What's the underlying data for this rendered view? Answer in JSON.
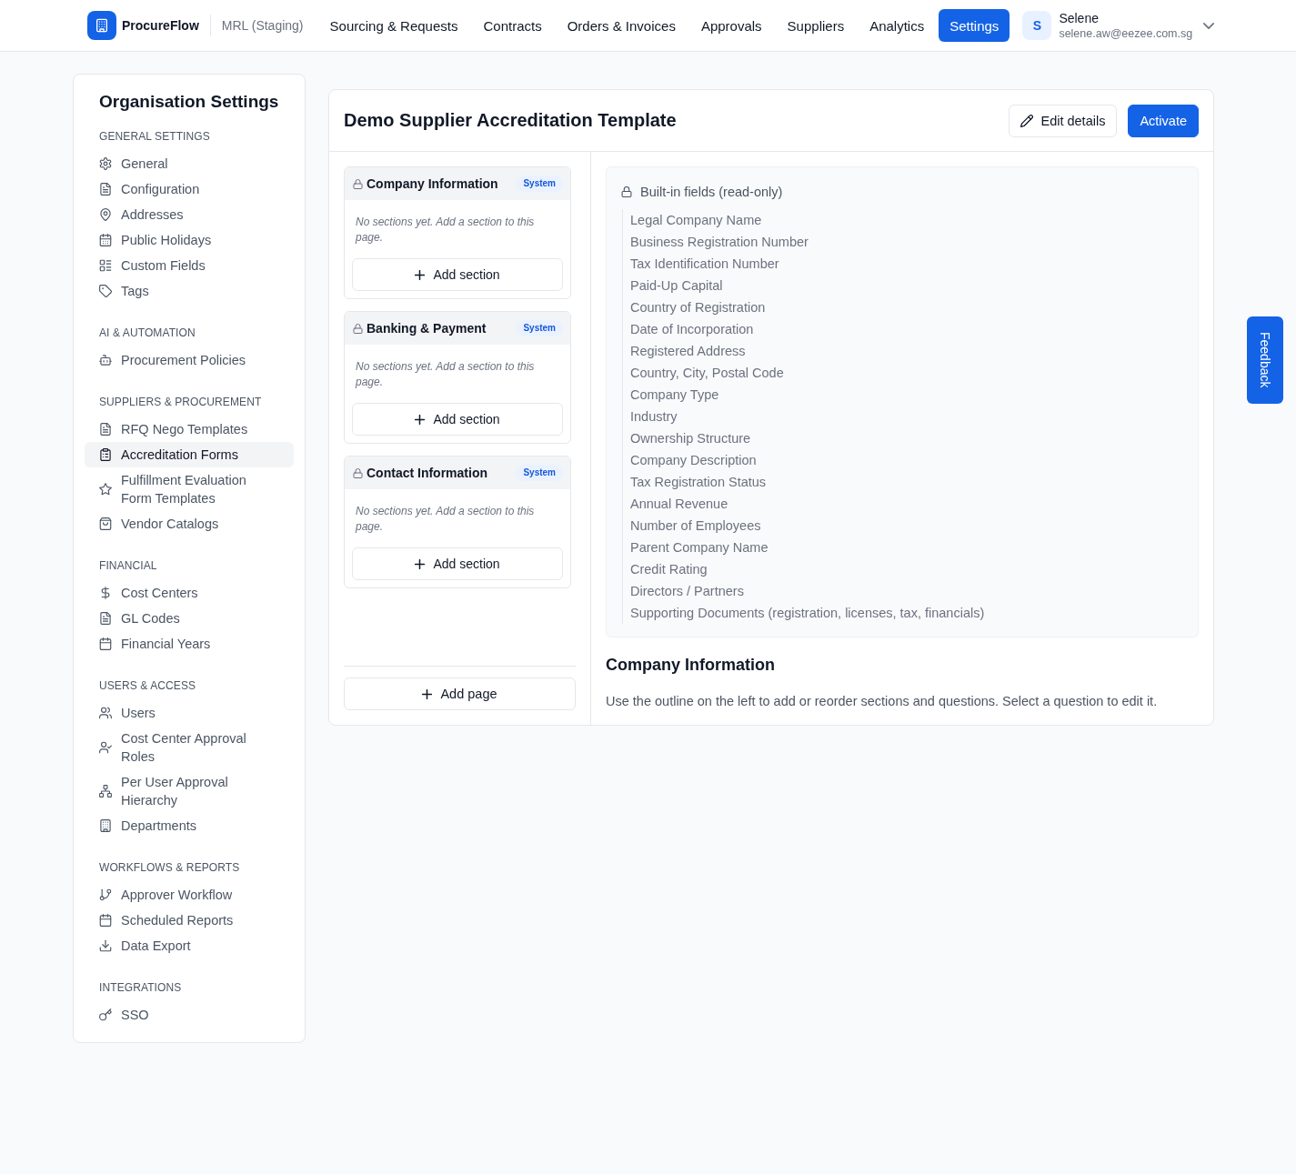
{
  "topbar": {
    "brand": "ProcureFlow",
    "workspace": "MRL (Staging)",
    "nav": [
      {
        "label": "Sourcing & Requests",
        "selected": false
      },
      {
        "label": "Contracts",
        "selected": false
      },
      {
        "label": "Orders & Invoices",
        "selected": false
      },
      {
        "label": "Approvals",
        "selected": false
      },
      {
        "label": "Suppliers",
        "selected": false
      },
      {
        "label": "Analytics",
        "selected": false
      },
      {
        "label": "Settings",
        "selected": true
      }
    ],
    "user": {
      "initial": "S",
      "name": "Selene",
      "email": "selene.aw@eezee.com.sg"
    }
  },
  "sidebar": {
    "title": "Organisation Settings",
    "groups": [
      {
        "heading": "GENERAL SETTINGS",
        "items": [
          {
            "label": "General",
            "selected": false
          },
          {
            "label": "Configuration",
            "selected": false
          },
          {
            "label": "Addresses",
            "selected": false
          },
          {
            "label": "Public Holidays",
            "selected": false
          },
          {
            "label": "Custom Fields",
            "selected": false
          },
          {
            "label": "Tags",
            "selected": false
          }
        ]
      },
      {
        "heading": "AI & AUTOMATION",
        "items": [
          {
            "label": "Procurement Policies",
            "selected": false
          }
        ]
      },
      {
        "heading": "SUPPLIERS & PROCUREMENT",
        "items": [
          {
            "label": "RFQ Nego Templates",
            "selected": false
          },
          {
            "label": "Accreditation Forms",
            "selected": true
          },
          {
            "label": "Fulfillment Evaluation Form Templates",
            "selected": false
          },
          {
            "label": "Vendor Catalogs",
            "selected": false
          }
        ]
      },
      {
        "heading": "FINANCIAL",
        "items": [
          {
            "label": "Cost Centers",
            "selected": false
          },
          {
            "label": "GL Codes",
            "selected": false
          },
          {
            "label": "Financial Years",
            "selected": false
          }
        ]
      },
      {
        "heading": "USERS & ACCESS",
        "items": [
          {
            "label": "Users",
            "selected": false
          },
          {
            "label": "Cost Center Approval Roles",
            "selected": false
          },
          {
            "label": "Per User Approval Hierarchy",
            "selected": false
          },
          {
            "label": "Departments",
            "selected": false
          }
        ]
      },
      {
        "heading": "WORKFLOWS & REPORTS",
        "items": [
          {
            "label": "Approver Workflow",
            "selected": false
          },
          {
            "label": "Scheduled Reports",
            "selected": false
          },
          {
            "label": "Data Export",
            "selected": false
          }
        ]
      },
      {
        "heading": "INTEGRATIONS",
        "items": [
          {
            "label": "SSO",
            "selected": false
          }
        ]
      }
    ]
  },
  "template": {
    "title": "Demo Supplier Accreditation Template",
    "actions": [
      {
        "label": "Edit details",
        "kind": "outline"
      },
      {
        "label": "Activate",
        "kind": "primary"
      }
    ],
    "pages": [
      {
        "title": "Company Information",
        "badge": "System",
        "empty_text": "No sections yet. Add a section to this page.",
        "add_button": "Add section"
      },
      {
        "title": "Banking & Payment",
        "badge": "System",
        "empty_text": "No sections yet. Add a section to this page.",
        "add_button": "Add section"
      },
      {
        "title": "Contact Information",
        "badge": "System",
        "empty_text": "No sections yet. Add a section to this page.",
        "add_button": "Add section"
      }
    ],
    "add_page_button": "Add page",
    "built_in": {
      "heading": "Built-in fields (read-only)",
      "fields": [
        "Legal Company Name",
        "Business Registration Number",
        "Tax Identification Number",
        "Paid-Up Capital",
        "Country of Registration",
        "Date of Incorporation",
        "Registered Address",
        "Country, City, Postal Code",
        "Company Type",
        "Industry",
        "Ownership Structure",
        "Company Description",
        "Tax Registration Status",
        "Annual Revenue",
        "Number of Employees",
        "Parent Company Name",
        "Credit Rating",
        "Directors / Partners",
        "Supporting Documents (registration, licenses, tax, financials)"
      ]
    },
    "section_title": "Company Information",
    "hint": "Use the outline on the left to add or reorder sections and questions. Select a question to edit it."
  },
  "feedback_button": "Feedback"
}
